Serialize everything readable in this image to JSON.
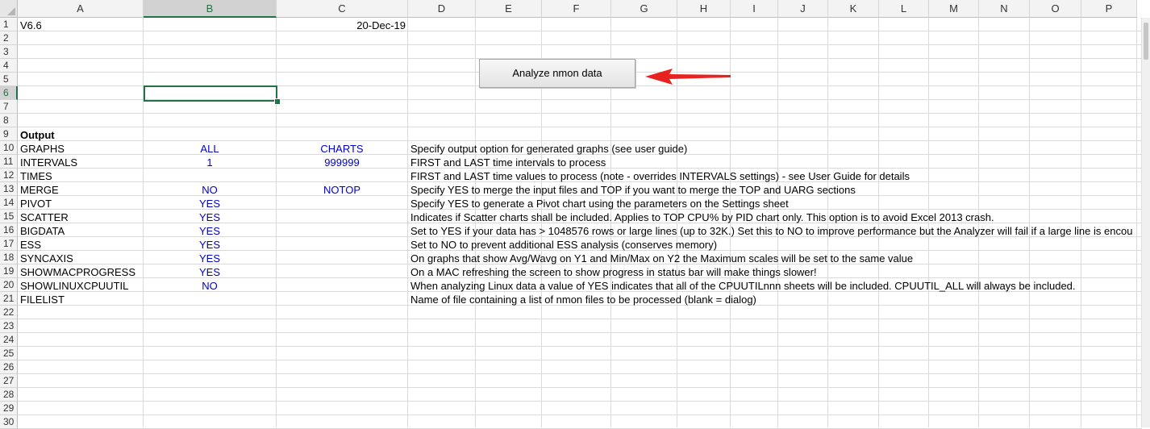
{
  "columns": [
    "A",
    "B",
    "C",
    "D",
    "E",
    "F",
    "G",
    "H",
    "I",
    "J",
    "K",
    "L",
    "M",
    "N",
    "O",
    "P"
  ],
  "selected_column": "B",
  "selected_row": 6,
  "rows": [
    "1",
    "2",
    "3",
    "4",
    "5",
    "6",
    "7",
    "8",
    "9",
    "10",
    "11",
    "12",
    "13",
    "14",
    "15",
    "16",
    "17",
    "18",
    "19",
    "20",
    "21",
    "22",
    "23",
    "24",
    "25",
    "26",
    "27",
    "28",
    "29",
    "30"
  ],
  "header": {
    "version": "V6.6",
    "date": "20-Dec-19"
  },
  "macro_button": {
    "label": "Analyze nmon data"
  },
  "output_label": "Output",
  "settings": [
    {
      "row": 10,
      "name": "GRAPHS",
      "b": "ALL",
      "c": "CHARTS",
      "desc": "Specify output option for generated graphs (see user guide)"
    },
    {
      "row": 11,
      "name": "INTERVALS",
      "b": "1",
      "c": "999999",
      "desc": "FIRST and LAST time intervals to process"
    },
    {
      "row": 12,
      "name": "TIMES",
      "b": "",
      "c": "",
      "desc": "FIRST and LAST time values to process (note - overrides INTERVALS settings) - see User Guide for details"
    },
    {
      "row": 13,
      "name": "MERGE",
      "b": "NO",
      "c": "NOTOP",
      "desc": "Specify YES to merge the input files and TOP if you want to merge the TOP and UARG sections"
    },
    {
      "row": 14,
      "name": "PIVOT",
      "b": "YES",
      "c": "",
      "desc": "Specify YES to generate a Pivot chart using the parameters on the Settings sheet"
    },
    {
      "row": 15,
      "name": "SCATTER",
      "b": "YES",
      "c": "",
      "desc": "Indicates if Scatter charts shall be included.  Applies to TOP CPU% by PID chart only.  This option is to avoid Excel 2013 crash."
    },
    {
      "row": 16,
      "name": "BIGDATA",
      "b": "YES",
      "c": "",
      "desc": "Set to YES if your data has > 1048576 rows or large lines (up to 32K.)  Set this to NO to improve performance but the Analyzer will fail if a large line is encou"
    },
    {
      "row": 17,
      "name": "ESS",
      "b": "YES",
      "c": "",
      "desc": "Set to NO to prevent additional ESS analysis (conserves memory)"
    },
    {
      "row": 18,
      "name": "SYNCAXIS",
      "b": "YES",
      "c": "",
      "desc": "On graphs that show Avg/Wavg on Y1 and Min/Max on Y2 the Maximum scales will be set to the same value"
    },
    {
      "row": 19,
      "name": "SHOWMACPROGRESS",
      "b": "YES",
      "c": "",
      "desc": "On a MAC refreshing the screen to show progress in status bar will make things slower!"
    },
    {
      "row": 20,
      "name": "SHOWLINUXCPUUTIL",
      "b": "NO",
      "c": "",
      "desc": "When analyzing Linux data a value of YES indicates that all of the CPUUTILnnn sheets will be included.  CPUUTIL_ALL will always be included."
    },
    {
      "row": 21,
      "name": "FILELIST",
      "b": "",
      "c": "",
      "desc": "Name of file containing a list of nmon files to be processed (blank = dialog)"
    }
  ],
  "colors": {
    "accent": "#217346",
    "value_text": "#0000cc",
    "arrow": "#e8231f"
  }
}
